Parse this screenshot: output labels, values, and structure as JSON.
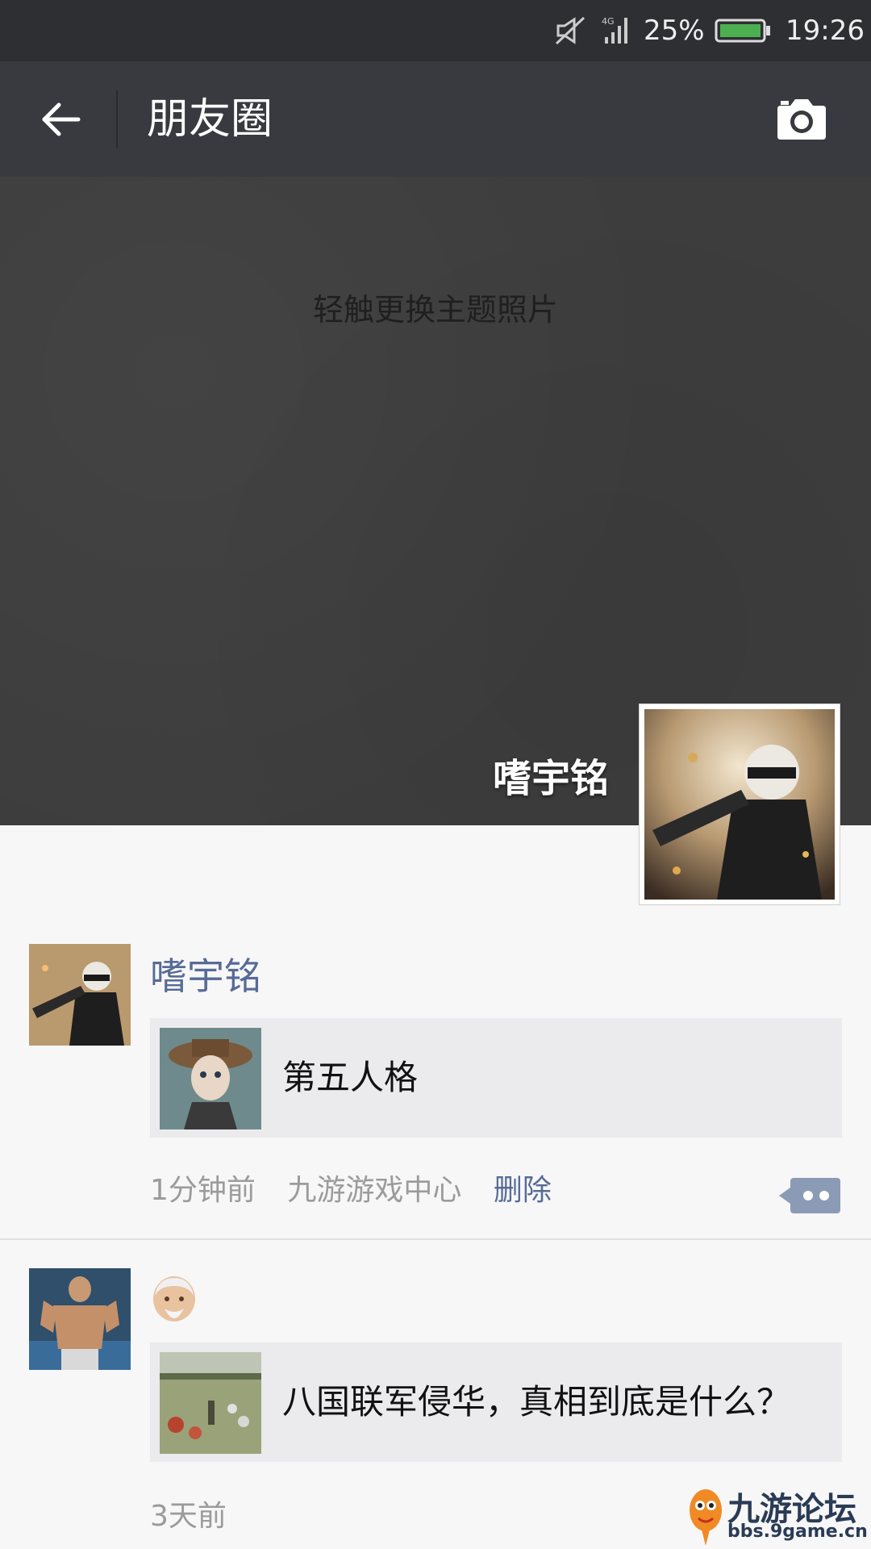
{
  "status_bar": {
    "battery_percent": "25%",
    "time": "19:26",
    "network": "4G",
    "icons": [
      "mute-icon",
      "signal-icon",
      "battery-icon"
    ]
  },
  "nav": {
    "title": "朋友圈",
    "back_icon": "arrow-left-icon",
    "camera_icon": "camera-icon"
  },
  "cover": {
    "hint": "轻触更换主题照片",
    "user_name": "嗜宇铭"
  },
  "posts": [
    {
      "author": "嗜宇铭",
      "card_title": "第五人格",
      "time": "1分钟前",
      "source": "九游游戏中心",
      "delete_label": "删除"
    },
    {
      "author_emoji": "👴🏼",
      "card_title": "八国联军侵华，真相到底是什么？",
      "time": "3天前"
    }
  ],
  "watermark": {
    "name": "九游论坛",
    "url": "bbs.9game.cn"
  },
  "colors": {
    "nav_bg": "#393a3f",
    "status_bg": "#2e2f33",
    "link": "#576b95",
    "card_bg": "#ebebed"
  }
}
